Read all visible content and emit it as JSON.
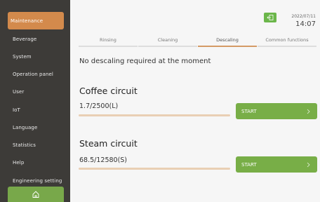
{
  "sidebar": {
    "items": [
      {
        "label": "Maintenance",
        "active": true
      },
      {
        "label": "Beverage"
      },
      {
        "label": "System"
      },
      {
        "label": "Operation panel"
      },
      {
        "label": "User"
      },
      {
        "label": "IoT"
      },
      {
        "label": "Language"
      },
      {
        "label": "Statistics"
      },
      {
        "label": "Help"
      },
      {
        "label": "Engineering setting"
      }
    ],
    "home_icon": "home-icon"
  },
  "header": {
    "date": "2022/07/11",
    "time": "14:07",
    "back_icon": "exit-icon"
  },
  "tabs": [
    {
      "label": "Rinsing"
    },
    {
      "label": "Cleaning"
    },
    {
      "label": "Descaling",
      "active": true
    },
    {
      "label": "Common functions"
    }
  ],
  "main": {
    "notice": "No descaling required at the moment",
    "coffee": {
      "title": "Coffee circuit",
      "counter": "1.7/2500(L)",
      "button": "START"
    },
    "steam": {
      "title": "Steam circuit",
      "counter": "68.5/12580(S)",
      "button": "START"
    }
  },
  "colors": {
    "sidebar_bg": "#3d3b38",
    "active_item": "#d38a4c",
    "accent_green": "#78ae47",
    "tab_underline": "#d49a66"
  }
}
